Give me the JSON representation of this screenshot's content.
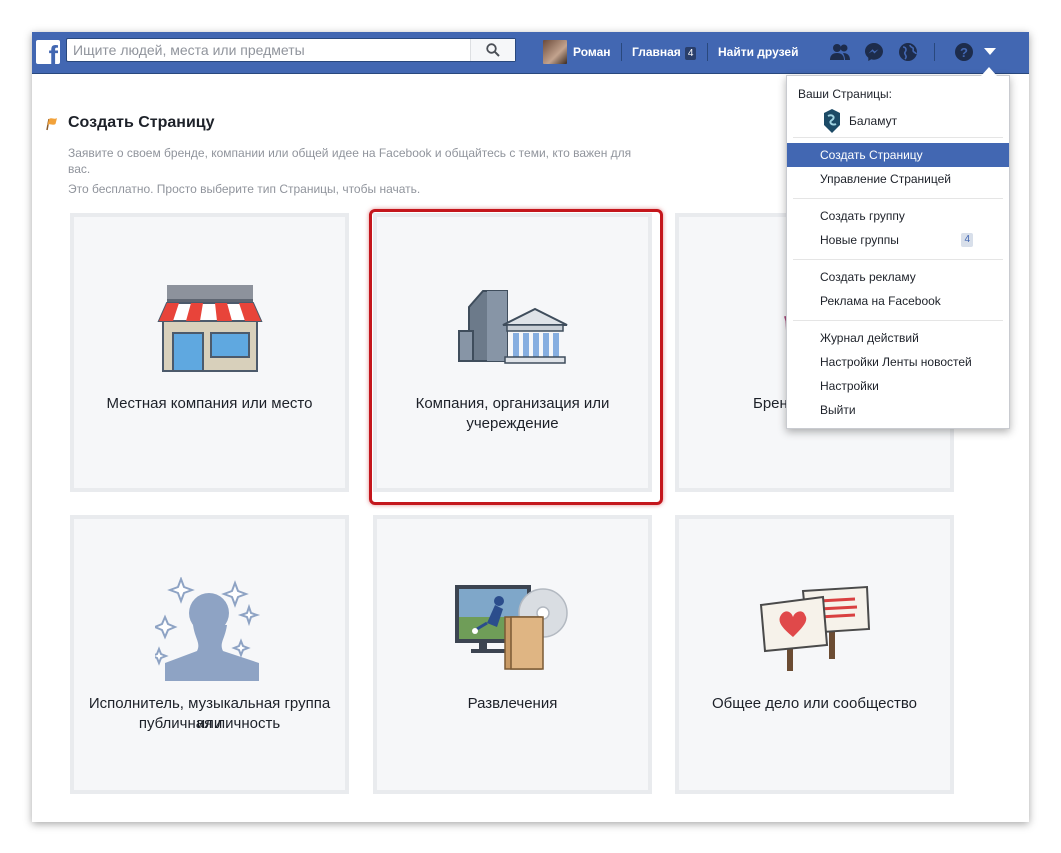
{
  "header": {
    "search_placeholder": "Ищите людей, места или предметы",
    "user_name": "Роман",
    "home_label": "Главная",
    "home_badge": "4",
    "find_friends_label": "Найти друзей"
  },
  "page": {
    "title": "Создать Страницу",
    "description": "Заявите о своем бренде, компании или общей идее на Facebook и общайтесь с теми, кто важен для вас.",
    "subtext": "Это бесплатно. Просто выберите тип Страницы, чтобы начать."
  },
  "tiles": [
    {
      "label": "Местная компания или место"
    },
    {
      "label_line1": "Компания, организация или",
      "label_line2": "учереждение"
    },
    {
      "label": "Бренд или продукт",
      "label_visible": "Бренд"
    },
    {
      "label_line1": "Исполнитель, музыкальная группа или",
      "label_line2": "публичная личность"
    },
    {
      "label": "Развлечения"
    },
    {
      "label": "Общее дело или сообщество"
    }
  ],
  "dropdown": {
    "pages_header": "Ваши Страницы:",
    "page_name": "Баламут",
    "items": [
      {
        "label": "Создать Страницу",
        "active": true
      },
      {
        "label": "Управление Страницей"
      },
      {
        "label": "Создать группу"
      },
      {
        "label": "Новые группы",
        "badge": "4"
      },
      {
        "label": "Создать рекламу"
      },
      {
        "label": "Реклама на Facebook"
      },
      {
        "label": "Журнал действий"
      },
      {
        "label": "Настройки Ленты новостей"
      },
      {
        "label": "Настройки"
      },
      {
        "label": "Выйти"
      }
    ]
  },
  "colors": {
    "brand": "#4267b2",
    "highlight": "#c4161c"
  }
}
